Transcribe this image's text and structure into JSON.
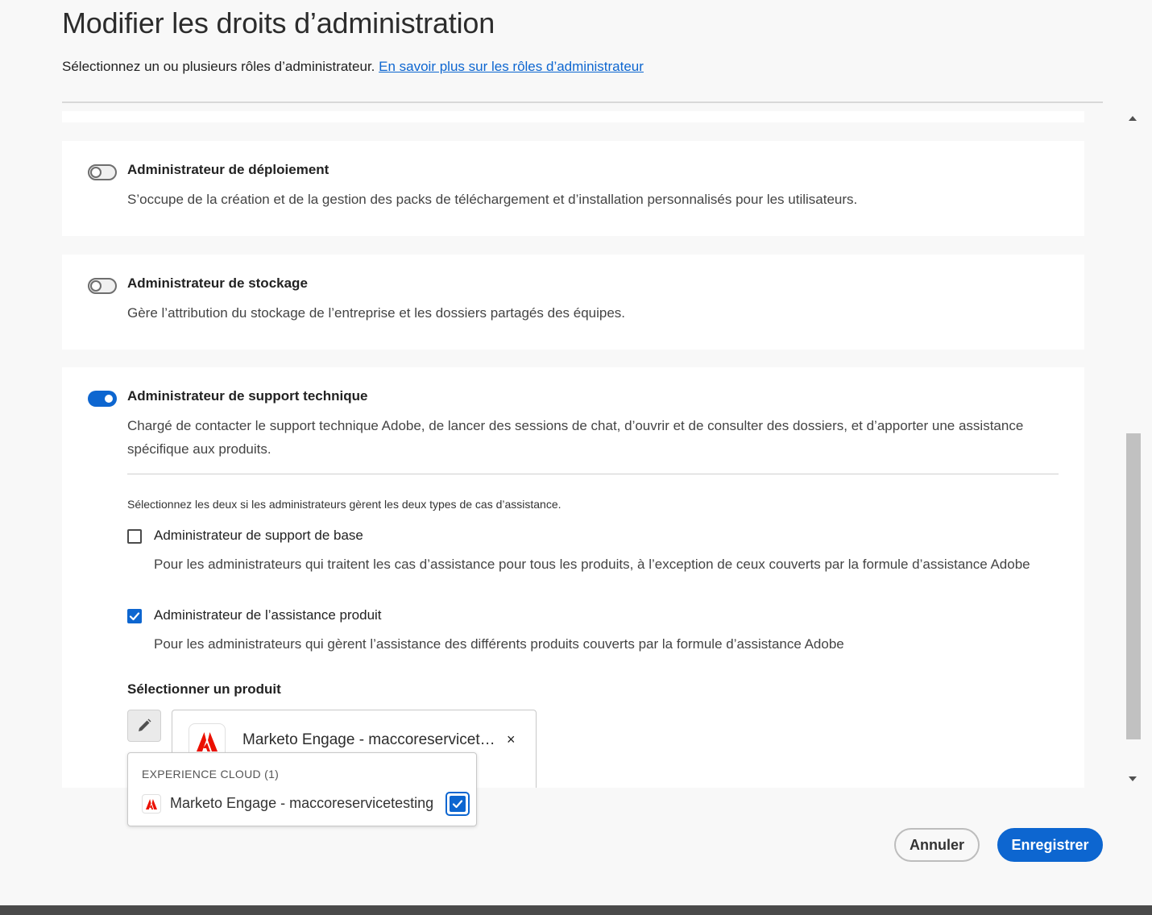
{
  "dialog": {
    "title": "Modifier les droits d’administration",
    "subtitle": "Sélectionnez un ou plusieurs rôles d’administrateur.",
    "subtitle_link": "En savoir plus sur les rôles d’administrateur"
  },
  "roles": [
    {
      "title": "Administrateur de déploiement",
      "description": "S’occupe de la création et de la gestion des packs de téléchargement et d’installation personnalisés pour les utilisateurs.",
      "enabled": false
    },
    {
      "title": "Administrateur de stockage",
      "description": "Gère l’attribution du stockage de l’entreprise et les dossiers partagés des équipes.",
      "enabled": false
    },
    {
      "title": "Administrateur de support technique",
      "description": "Chargé de contacter le support technique Adobe, de lancer des sessions de chat, d’ouvrir et de consulter des dossiers, et d’apporter une assistance spécifique aux produits.",
      "enabled": true
    }
  ],
  "support": {
    "hint": "Sélectionnez les deux si les administrateurs gèrent les deux types de cas d’assistance.",
    "options": [
      {
        "title": "Administrateur de support de base",
        "description": "Pour les administrateurs qui traitent les cas d’assistance pour tous les produits, à l’exception de ceux couverts par la formule d’assistance Adobe",
        "checked": false
      },
      {
        "title": "Administrateur de l’assistance produit",
        "description": "Pour les administrateurs qui gèrent l’assistance des différents produits couverts par la formule d’assistance Adobe",
        "checked": true
      }
    ],
    "select_label": "Sélectionner un produit",
    "selected_product": "Marketo Engage - maccoreservicetesting",
    "remove_symbol": "×"
  },
  "popover": {
    "heading": "EXPERIENCE CLOUD (1)",
    "items": [
      {
        "label": "Marketo Engage - maccoreservicetesting",
        "checked": true
      }
    ]
  },
  "footer": {
    "cancel_label": "Annuler",
    "save_label": "Enregistrer"
  },
  "colors": {
    "accent": "#0d66d0",
    "adobe_red": "#eb1000",
    "background": "#f8f8f8"
  },
  "icons": {
    "edit": "pencil-icon",
    "product": "adobe-logo-icon",
    "remove": "close-icon"
  }
}
